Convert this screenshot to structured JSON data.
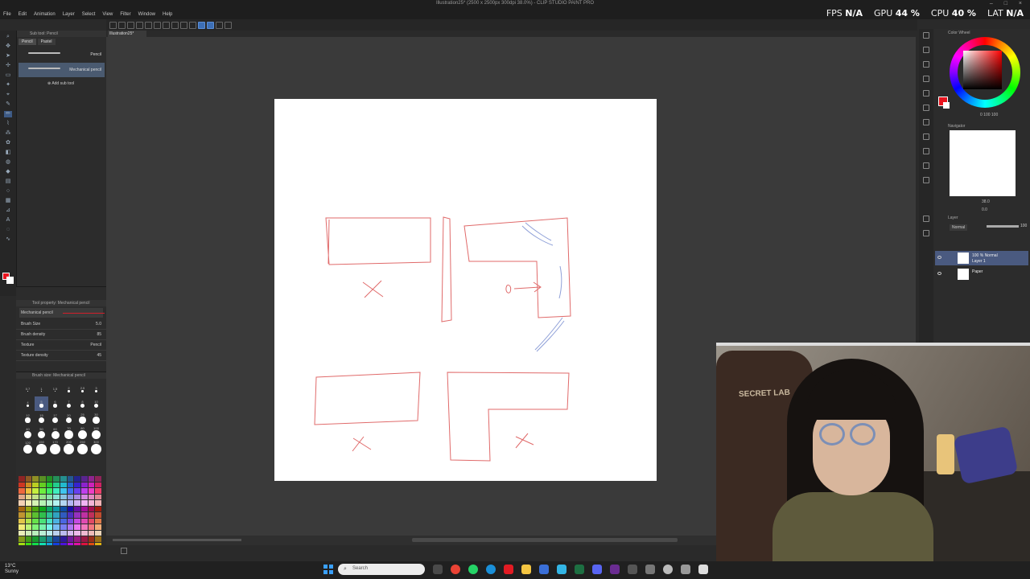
{
  "window": {
    "title": "Illustration25* (2500 x 2500px 300dpi 38.0%) - CLIP STUDIO PAINT PRO",
    "controls": "– □ ×"
  },
  "menu": [
    "File",
    "Edit",
    "Animation",
    "Layer",
    "Select",
    "View",
    "Filter",
    "Window",
    "Help"
  ],
  "stats": {
    "fps_label": "FPS",
    "fps_value": "N/A",
    "gpu_label": "GPU",
    "gpu_value": "44 %",
    "cpu_label": "CPU",
    "cpu_value": "40 %",
    "lat_label": "LAT",
    "lat_value": "N/A"
  },
  "document_tab": "Illustration25*",
  "subtool": {
    "header": "Sub tool: Pencil",
    "tabs": [
      "Pencil",
      "Pastel"
    ],
    "items": [
      {
        "name": "Pencil"
      },
      {
        "name": "Mechanical pencil"
      }
    ],
    "add_label": "Add sub tool"
  },
  "toolprop": {
    "header": "Tool property: Mechanical pencil",
    "preview_name": "Mechanical pencil",
    "rows": [
      {
        "label": "Brush Size",
        "value": "5.0"
      },
      {
        "label": "Brush density",
        "value": "85"
      },
      {
        "label": "Texture",
        "value": "Pencil"
      },
      {
        "label": "Texture density",
        "value": "45"
      }
    ]
  },
  "brushsize": {
    "header": "Brush size: Mechanical pencil",
    "sizes": [
      "0.7",
      "1",
      "1.5",
      "2",
      "2.5",
      "3",
      "4",
      "5",
      "6",
      "7",
      "8",
      "10",
      "12",
      "15",
      "17",
      "20",
      "25",
      "30",
      "40",
      "50",
      "60",
      "70",
      "80",
      "100",
      "120",
      "150",
      "170",
      "200",
      "250",
      "300"
    ]
  },
  "colors": {
    "main": "#e8141e",
    "sub": "#ffffff",
    "accent": "#3d6fb6",
    "panel_bg": "#2c2c2c"
  },
  "colorwheel": {
    "header": "Color Wheel",
    "values": "0  100  100"
  },
  "navigator": {
    "header": "Navigator",
    "zoom": "38.0",
    "angle": "0.0"
  },
  "layers": {
    "header": "Layer",
    "blend_mode": "Normal",
    "opacity": "100",
    "items": [
      {
        "line1": "100 % Normal",
        "line2": "Layer 1",
        "selected": true
      },
      {
        "line1": "Paper",
        "line2": "",
        "selected": false
      }
    ]
  },
  "webcam": {
    "chair_text": "SECRET LAB"
  },
  "taskbar": {
    "weather_temp": "13°C",
    "weather_desc": "Sunny",
    "search_placeholder": "Search"
  }
}
